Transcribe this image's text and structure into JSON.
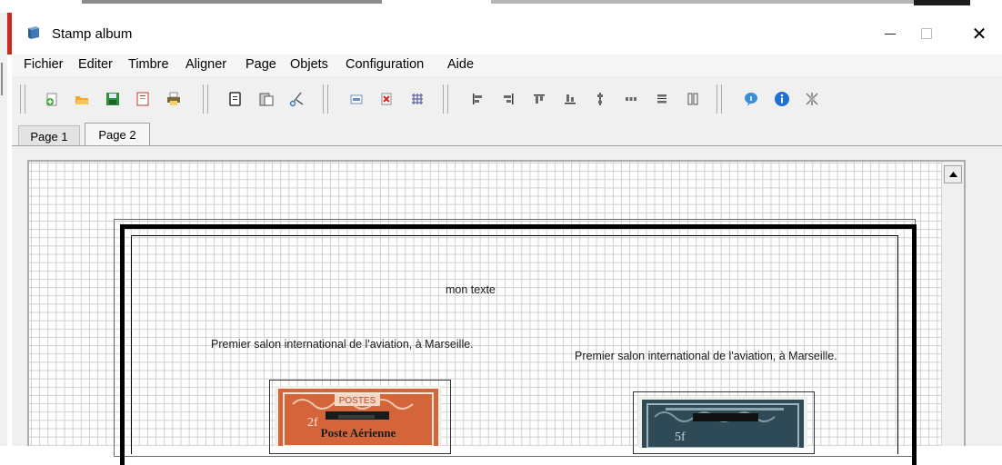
{
  "window": {
    "title": "Stamp album"
  },
  "window_controls": {
    "minimize": "—",
    "maximize": "☐",
    "close": "✕"
  },
  "menu": [
    "Fichier",
    "Editer",
    "Timbre",
    "Aligner",
    "Page",
    "Objets",
    "Configuration",
    "Aide"
  ],
  "toolbar": {
    "groups": [
      [
        "new-icon",
        "open-icon",
        "save-icon",
        "page-setup-icon",
        "print-icon"
      ],
      [
        "copy-icon",
        "paste-icon",
        "cut-icon"
      ],
      [
        "insert-image-icon",
        "delete-icon",
        "grid-icon"
      ],
      [
        "align-left-icon",
        "align-right-icon",
        "align-top-icon",
        "align-bottom-icon",
        "center-vertical-icon",
        "distribute-horizontal-icon",
        "distribute-vertical-icon",
        "same-size-icon"
      ],
      [
        "help-icon",
        "info-icon",
        "settings-icon"
      ]
    ]
  },
  "tabs": [
    {
      "label": "Page 1",
      "active": false
    },
    {
      "label": "Page 2",
      "active": true
    }
  ],
  "canvas": {
    "text_items": {
      "mon_texte": "mon texte",
      "caption_left": "Premier salon international de l'aviation, à Marseille.",
      "caption_right": "Premier salon international de l'aviation, à Marseille."
    },
    "stamp_left": {
      "top_text": "POSTES",
      "overprint": "Poste Aérienne",
      "value": "2f"
    },
    "stamp_right": {
      "value": "5f"
    }
  },
  "colors": {
    "stamp_left_main": "#d4653a",
    "stamp_right_main": "#2d4a56",
    "grid_line": "#cfcfcf",
    "border_thick": "#000000"
  }
}
